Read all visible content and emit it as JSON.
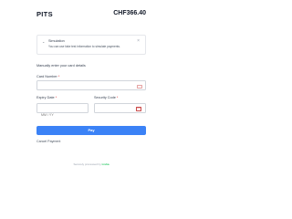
{
  "header": {
    "merchant": "PITS",
    "amount": "CHF366.40"
  },
  "notice": {
    "title": "Simulation",
    "description": "You can use fake test information to simulate payments."
  },
  "form": {
    "intro": "Manually enter your card details",
    "card_number_label": "Card Number",
    "expiry_label": "Expiry Date",
    "expiry_placeholder": "MM / YY",
    "security_label": "Security Code",
    "required_mark": "*"
  },
  "actions": {
    "pay_label": "Pay",
    "cancel_label": "Cancel Payment"
  },
  "footer": {
    "secured_text": "Securely processed by",
    "brand": "Lisha"
  },
  "colors": {
    "primary": "#3b82f6",
    "required": "#dc2626",
    "brand": "#22c55e"
  }
}
